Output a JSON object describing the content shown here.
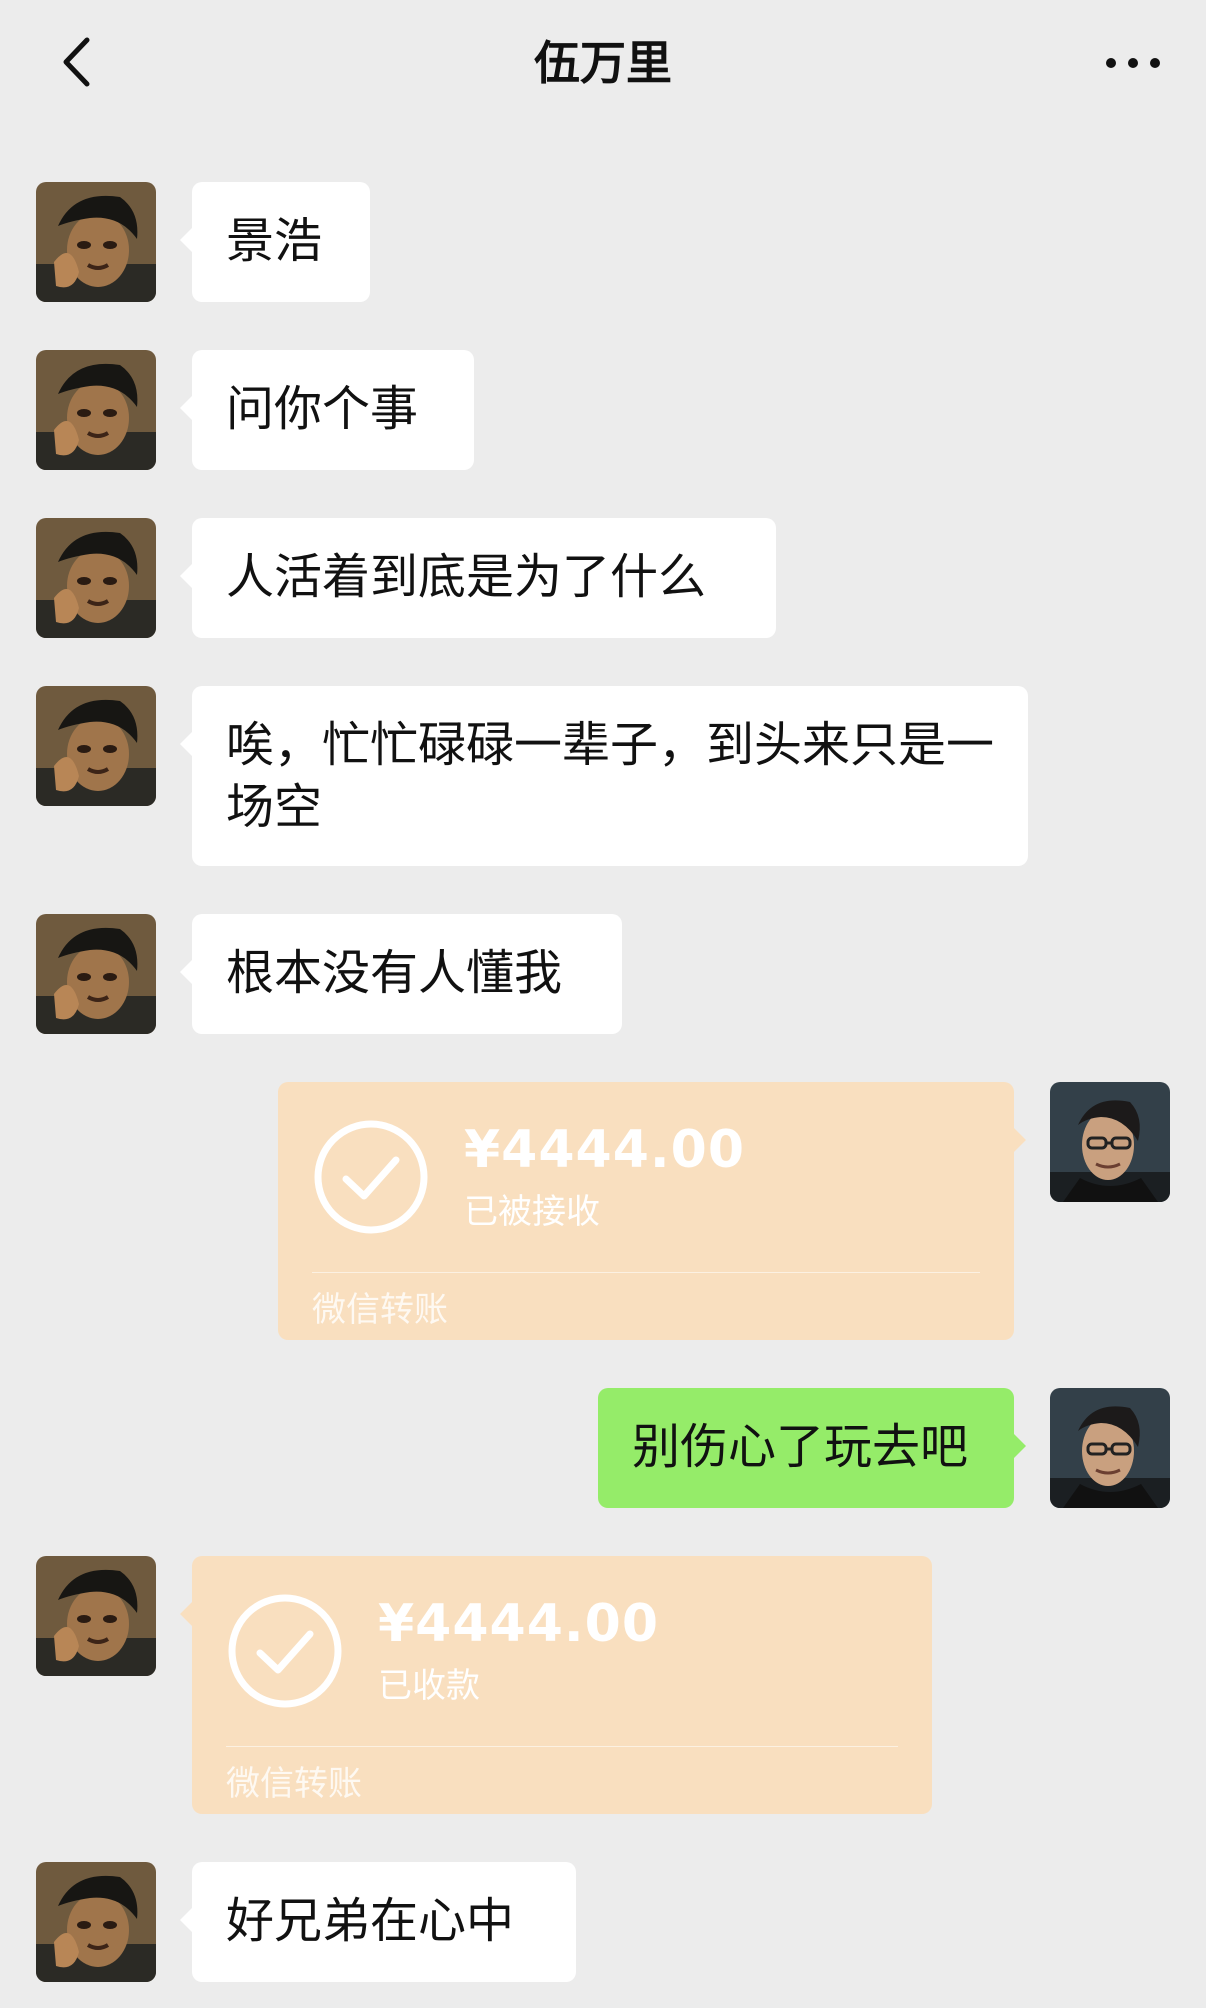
{
  "header": {
    "title": "伍万里"
  },
  "messages": [
    {
      "side": "left",
      "type": "text",
      "text": "景浩"
    },
    {
      "side": "left",
      "type": "text",
      "text": "问你个事"
    },
    {
      "side": "left",
      "type": "text",
      "text": "人活着到底是为了什么"
    },
    {
      "side": "left",
      "type": "text",
      "text": "唉，忙忙碌碌一辈子，到头来只是一场空"
    },
    {
      "side": "left",
      "type": "text",
      "text": "根本没有人懂我"
    },
    {
      "side": "right",
      "type": "transfer",
      "amount": "¥4444.00",
      "status": "已被接收",
      "footer": "微信转账"
    },
    {
      "side": "right",
      "type": "text",
      "text": "别伤心了玩去吧"
    },
    {
      "side": "left",
      "type": "transfer",
      "amount": "¥4444.00",
      "status": "已收款",
      "footer": "微信转账"
    },
    {
      "side": "left",
      "type": "text",
      "text": "好兄弟在心中"
    }
  ],
  "colors": {
    "background": "#ececec",
    "left_bubble": "#ffffff",
    "right_bubble": "#95ec69",
    "transfer_bubble": "#f9dfbf",
    "text": "#111111"
  },
  "icons": {
    "back": "chevron-left-icon",
    "more": "more-dots-icon",
    "transfer": "check-circle-icon"
  }
}
